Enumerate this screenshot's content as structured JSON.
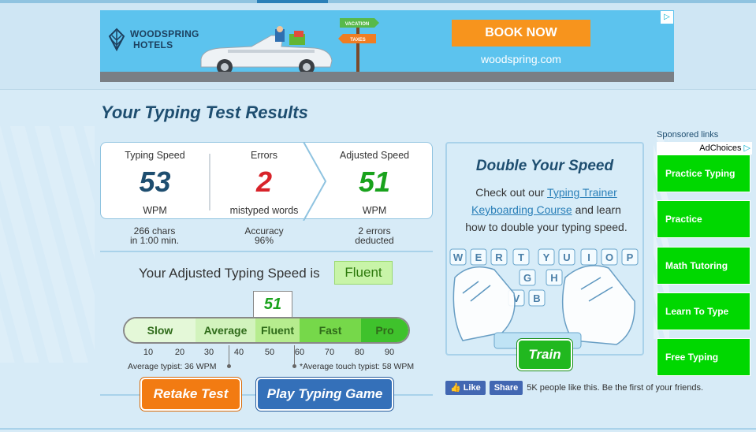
{
  "ad": {
    "brand_line1": "WOODSPRING",
    "brand_line2": "HOTELS",
    "sign_vacation": "VACATION",
    "sign_taxes": "TAXES",
    "cta": "BOOK NOW",
    "url": "woodspring.com"
  },
  "results": {
    "title": "Your Typing Test Results",
    "speed": {
      "label": "Typing Speed",
      "value": "53",
      "unit": "WPM",
      "sub_line1": "266 chars",
      "sub_line2": "in 1:00 min."
    },
    "errors": {
      "label": "Errors",
      "value": "2",
      "unit": "mistyped words",
      "sub_line1": "Accuracy",
      "sub_line2": "96%"
    },
    "adjusted": {
      "label": "Adjusted Speed",
      "value": "51",
      "unit": "WPM",
      "sub_line1": "2 errors",
      "sub_line2": "deducted"
    },
    "level_text": "Your Adjusted Typing Speed is",
    "level_badge": "Fluent",
    "marker_value": "51",
    "scale": [
      "Slow",
      "Average",
      "Fluent",
      "Fast",
      "Pro"
    ],
    "ticks": [
      "10",
      "20",
      "30",
      "40",
      "50",
      "60",
      "70",
      "80",
      "90"
    ],
    "avg_note": "Average typist: 36 WPM",
    "touch_note": "*Average touch typist: 58 WPM",
    "retake": "Retake Test",
    "play": "Play Typing Game"
  },
  "promo": {
    "title": "Double Your Speed",
    "text_pre": "Check out our",
    "link1": "Typing Trainer",
    "link2": "Keyboarding Course",
    "text_post": "and learn how to double your typing speed.",
    "keys_row1": [
      "W",
      "E",
      "R",
      "T",
      "Y",
      "U",
      "I",
      "O",
      "P"
    ],
    "keys_row2": [
      "G",
      "H"
    ],
    "keys_row3": [
      "V",
      "B"
    ],
    "train": "Train"
  },
  "facebook": {
    "like": "Like",
    "share": "Share",
    "text": "5K people like this. Be the first of your friends."
  },
  "sidebar": {
    "sponsored": "Sponsored links",
    "adchoices": "AdChoices",
    "links": [
      "Practice Typing",
      "Practice",
      "Math Tutoring",
      "Learn To Type",
      "Free Typing"
    ]
  },
  "colors": {
    "accent_blue": "#1e4e70",
    "green": "#19a21c",
    "red": "#d8232a",
    "orange": "#f27b12"
  }
}
